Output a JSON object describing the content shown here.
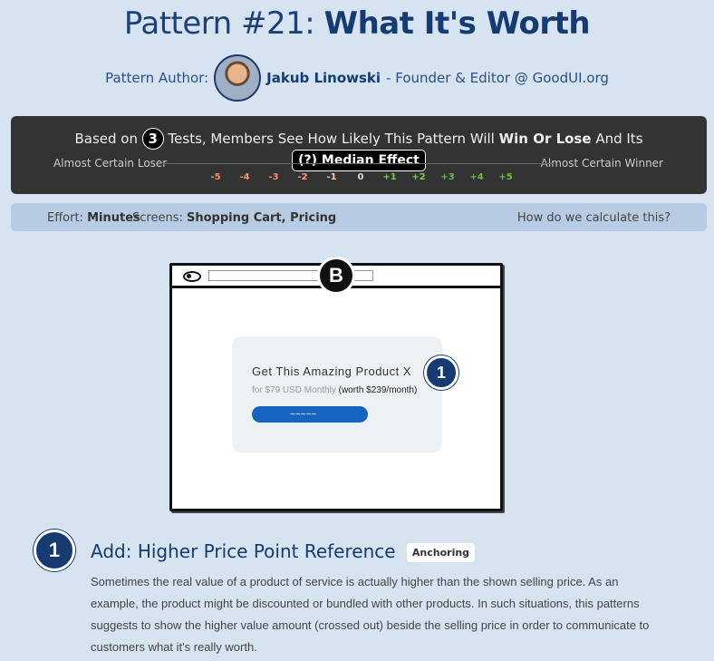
{
  "title": {
    "prefix": "Pattern #21: ",
    "name": "What It's Worth"
  },
  "author": {
    "label": "Pattern Author:",
    "name": "Jakub Linowski",
    "role": " - Founder & Editor @ GoodUI.org"
  },
  "panel": {
    "based_on": "Based on",
    "tests_count": "3",
    "tests_text": "Tests, Members See How Likely This Pattern Will",
    "win_lose": "Win Or Lose",
    "and_its": "And Its",
    "median": "(?) Median Effect",
    "left_label": "Almost Certain Loser",
    "right_label": "Almost Certain Winner",
    "scale": [
      {
        "v": "-5",
        "color": "#ff8a65"
      },
      {
        "v": "-4",
        "color": "#ff8a65"
      },
      {
        "v": "-3",
        "color": "#ff8a65"
      },
      {
        "v": "-2",
        "color": "#ff9e80"
      },
      {
        "v": "-1",
        "color": "#ffccbc"
      },
      {
        "v": "0",
        "color": "#dddddd"
      },
      {
        "v": "+1",
        "color": "#8bc34a"
      },
      {
        "v": "+2",
        "color": "#8bc34a"
      },
      {
        "v": "+3",
        "color": "#7cb342"
      },
      {
        "v": "+4",
        "color": "#7cb342"
      },
      {
        "v": "+5",
        "color": "#7cb342"
      }
    ]
  },
  "infobar": {
    "effort_label": "Effort:",
    "effort_value": "Minutes",
    "screens_label": "Screens:",
    "screens_value": "Shopping Cart, Pricing",
    "calc_link": "How do we calculate this?"
  },
  "sketch": {
    "variant": "B",
    "product_title": "Get This Amazing Product X",
    "price": "for $79 USD Monthly",
    "worth": "(worth $239/month)",
    "button_scribble": "~~~~~",
    "marker": "1"
  },
  "item": {
    "number": "1",
    "title": "Add: Higher Price Point Reference",
    "tag": "Anchoring",
    "description": "Sometimes the real value of a product of service is actually higher than the shown selling price. As an example, the product might be discounted or bundled with other products. In such situations, this patterns suggests to show the higher value amount (crossed out) beside the selling price in order to communicate to customers what it's really worth."
  }
}
